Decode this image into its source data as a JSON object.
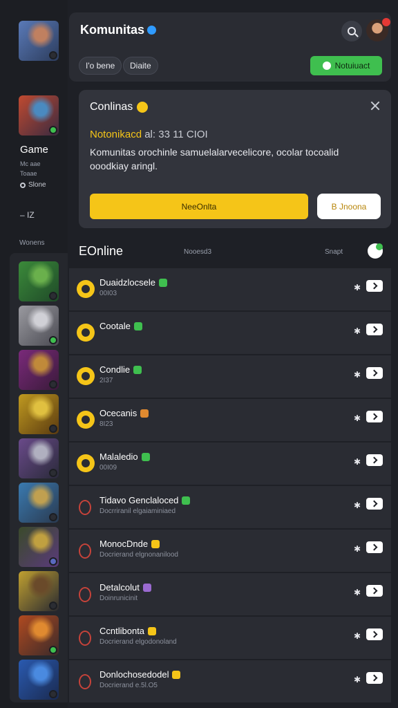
{
  "header": {
    "title": "Komunitas",
    "pills": [
      "I'o bene",
      "Diaite"
    ],
    "notify_label": "Notuiuact"
  },
  "rail": {
    "game_label": "Game",
    "line1": "Mc aae",
    "line2": "Toaae",
    "stat": "Slone",
    "iz": "– IZ",
    "section": "Wonens",
    "top_avatars": [
      {
        "colors": [
          "#5a7ab8",
          "#c08060",
          "#2c3c5c"
        ],
        "dot": "#2b2d33"
      },
      {
        "colors": [
          "#c04a30",
          "#4a8ac0",
          "#3a2a40"
        ],
        "dot": "#3fbf4f"
      }
    ],
    "list_avatars": [
      {
        "colors": [
          "#3b8a3a",
          "#6ab04c",
          "#1f4a28"
        ],
        "dot": "#2b2d33"
      },
      {
        "colors": [
          "#9a9aa0",
          "#d0d0d6",
          "#4a4a52"
        ],
        "dot": "#3fbf4f"
      },
      {
        "colors": [
          "#7a2a7a",
          "#c08a3a",
          "#3a1a3a"
        ],
        "dot": "#2b2d33"
      },
      {
        "colors": [
          "#c09a20",
          "#e0c040",
          "#5a3a10"
        ],
        "dot": "#2b2d33"
      },
      {
        "colors": [
          "#6a4a8a",
          "#b0b0c0",
          "#2a2a3a"
        ],
        "dot": "#2b2d33"
      },
      {
        "colors": [
          "#3a7ab0",
          "#c0a050",
          "#2a3a50"
        ],
        "dot": "#2b2d33"
      },
      {
        "colors": [
          "#3a4a2a",
          "#c0a040",
          "#5a3a7a"
        ],
        "dot": "#5a6ac0"
      },
      {
        "colors": [
          "#c0a030",
          "#6a4a2a",
          "#2a2a30"
        ],
        "dot": "#2b2d33"
      },
      {
        "colors": [
          "#b04a20",
          "#e08a30",
          "#3a2a2a"
        ],
        "dot": "#3fbf4f"
      },
      {
        "colors": [
          "#2a5ab0",
          "#4a8ae0",
          "#1a2a50"
        ],
        "dot": "#2b2d33"
      }
    ]
  },
  "dialog": {
    "title": "Conlinas",
    "highlight": "Notonikacd",
    "highlight_rest": "al: 33  11 CIOI",
    "body": "Komunitas orochinle samuelalarvecelicore, ocolar tocoalid ooodkiay aringl.",
    "primary": "NeeOnlta",
    "secondary": "B Jnoona"
  },
  "online": {
    "title": "EOnline",
    "mid": "Nooesd3",
    "right": "Snapt",
    "rows": [
      {
        "name": "Duaidzlocsele",
        "sub": "00I03",
        "icon": "filled",
        "tag": "#3fbf4f"
      },
      {
        "name": "Cootale",
        "sub": "",
        "icon": "filled",
        "tag": "#3fbf4f"
      },
      {
        "name": "Condlie",
        "sub": "2I37",
        "icon": "filled",
        "tag": "#3fbf4f"
      },
      {
        "name": "Ocecanis",
        "sub": "8I23",
        "icon": "filled",
        "tag": "#e08a30"
      },
      {
        "name": "Malaledio",
        "sub": "00I09",
        "icon": "filled",
        "tag": "#3fbf4f"
      },
      {
        "name": "Tidavo Genclaloced",
        "sub": "Docrriranil elgaiaminiaed",
        "icon": "outline",
        "tag": "#3fbf4f"
      },
      {
        "name": "MonocDnde",
        "sub": "Docrierand elgnonanilood",
        "icon": "outline",
        "tag": "#f5c518"
      },
      {
        "name": "Detalcolut",
        "sub": "Doinrunicinit",
        "icon": "outline",
        "tag": "#9a6ad0"
      },
      {
        "name": "Ccntlibonta",
        "sub": "Docrierand elgodonoland",
        "icon": "outline",
        "tag": "#f5c518"
      },
      {
        "name": "Donlochosedodel",
        "sub": "Docrierand e.5l.O5",
        "icon": "outline",
        "tag": "#f5c518"
      }
    ]
  }
}
